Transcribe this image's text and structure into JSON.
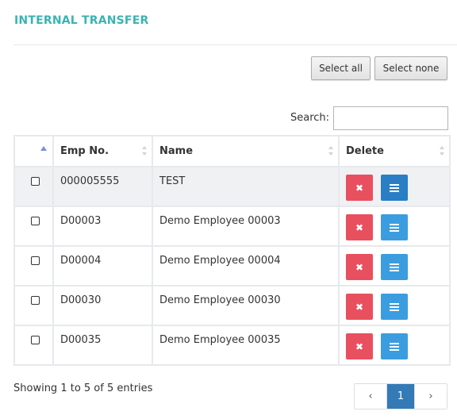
{
  "page": {
    "title": "INTERNAL TRANSFER"
  },
  "toolbar": {
    "select_all_label": "Select all",
    "select_none_label": "Select none"
  },
  "search": {
    "label": "Search:",
    "value": ""
  },
  "table": {
    "columns": [
      "",
      "Emp No.",
      "Name",
      "Delete"
    ],
    "rows": [
      {
        "emp_no": "000005555",
        "name": "TEST"
      },
      {
        "emp_no": "D00003",
        "name": "Demo Employee 00003"
      },
      {
        "emp_no": "D00004",
        "name": "Demo Employee 00004"
      },
      {
        "emp_no": "D00030",
        "name": "Demo Employee 00030"
      },
      {
        "emp_no": "D00035",
        "name": "Demo Employee 00035"
      }
    ]
  },
  "footer": {
    "info": "Showing 1 to 5 of 5 entries",
    "pagination": {
      "prev": "‹",
      "current": "1",
      "next": "›"
    }
  },
  "icons": {
    "delete": "close-icon",
    "details": "list-icon"
  },
  "colors": {
    "title": "#3bb3b3",
    "delete": "#e8505f",
    "details": "#3b9de0",
    "page_active": "#337ab7"
  }
}
